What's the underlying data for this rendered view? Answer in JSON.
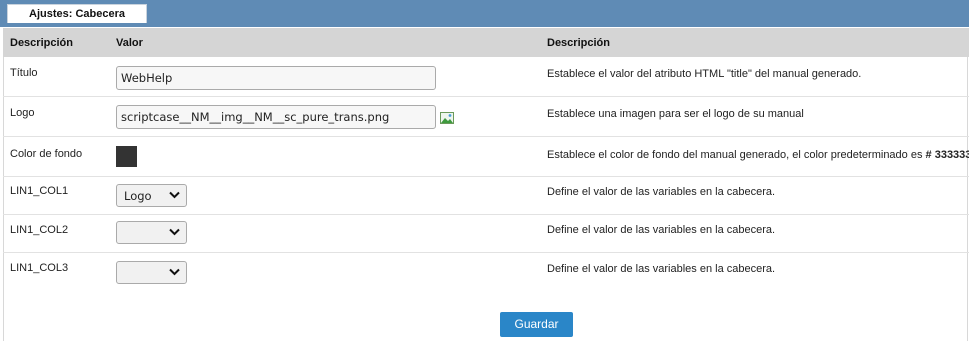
{
  "tab": {
    "label": "Ajustes: Cabecera"
  },
  "header": {
    "col1": "Descripción",
    "col2": "Valor",
    "col3": "Descripción"
  },
  "rows": [
    {
      "label": "Título",
      "value": "WebHelp",
      "desc": "Establece el valor del atributo HTML \"title\" del manual generado."
    },
    {
      "label": "Logo",
      "value": "scriptcase__NM__img__NM__sc_pure_trans.png",
      "icon": "image-icon",
      "desc": "Establece una imagen para ser el logo de su manual"
    },
    {
      "label": "Color de fondo",
      "color": "#333333",
      "desc_prefix": "Establece el color de fondo del manual generado, el color predeterminado es ",
      "desc_bold": "# 333333"
    },
    {
      "label": "LIN1_COL1",
      "selected": "Logo",
      "desc": "Define el valor de las variables en la cabecera."
    },
    {
      "label": "LIN1_COL2",
      "selected": "",
      "desc": "Define el valor de las variables en la cabecera."
    },
    {
      "label": "LIN1_COL3",
      "selected": "",
      "desc": "Define el valor de las variables en la cabecera."
    }
  ],
  "save_button": {
    "label": "Guardar"
  },
  "colors": {
    "tabbar": "#5f8bb5",
    "header_bg": "#d5d5d5",
    "button": "#2a86c8"
  }
}
